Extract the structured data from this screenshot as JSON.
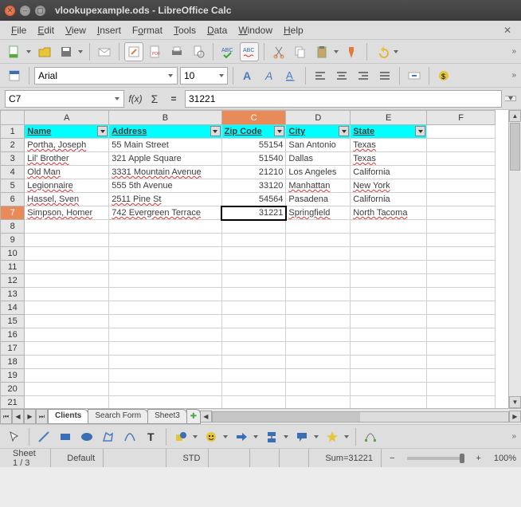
{
  "window": {
    "title": "vlookupexample.ods - LibreOffice Calc"
  },
  "menu": {
    "file": "File",
    "edit": "Edit",
    "view": "View",
    "insert": "Insert",
    "format": "Format",
    "tools": "Tools",
    "data": "Data",
    "window": "Window",
    "help": "Help"
  },
  "formatbar": {
    "font_name": "Arial",
    "font_size": "10"
  },
  "formula": {
    "cell_ref": "C7",
    "content": "31221"
  },
  "columns": {
    "A": "A",
    "B": "B",
    "C": "C",
    "D": "D",
    "E": "E",
    "F": "F"
  },
  "headers": {
    "name": "Name",
    "address": "Address",
    "zip": "Zip Code",
    "city": "City",
    "state": "State"
  },
  "rows": [
    {
      "name": "Portha, Joseph",
      "address": "55 Main Street",
      "zip": "55154",
      "city": "San Antonio",
      "state": "Texas"
    },
    {
      "name": "Lil' Brother",
      "address": "321 Apple Square",
      "zip": "51540",
      "city": "Dallas",
      "state": "Texas"
    },
    {
      "name": "Old Man",
      "address": "3331 Mountain Avenue",
      "zip": "21210",
      "city": "Los Angeles",
      "state": "California"
    },
    {
      "name": "Legionnaire",
      "address": "555 5th Avenue",
      "zip": "33120",
      "city": "Manhattan",
      "state": "New York"
    },
    {
      "name": "Hassel, Sven",
      "address": "2511 Pine St",
      "zip": "54564",
      "city": "Pasadena",
      "state": "California"
    },
    {
      "name": "Simpson, Homer",
      "address": "742 Evergreen Terrace",
      "zip": "31221",
      "city": "Springfield",
      "state": "North Tacoma"
    }
  ],
  "tabs": {
    "t1": "Clients",
    "t2": "Search Form",
    "t3": "Sheet3"
  },
  "status": {
    "sheet": "Sheet 1 / 3",
    "style": "Default",
    "ovr": "STD",
    "sum": "Sum=31221",
    "zoom": "100%"
  },
  "chart_data": null
}
